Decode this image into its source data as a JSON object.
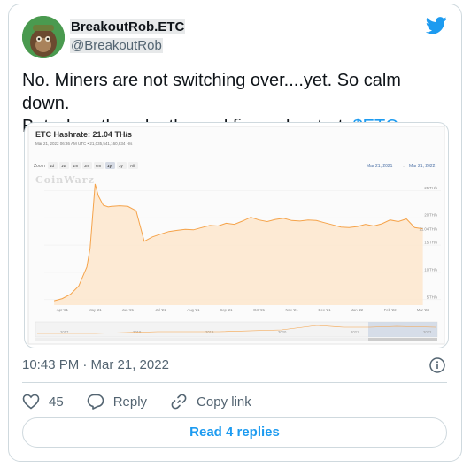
{
  "author": {
    "name": "BreakoutRob.ETC",
    "handle": "@BreakoutRob"
  },
  "tweet": {
    "text_line1": "No. Miners are not switching over....yet. So calm down.",
    "text_line2_plain": "But when they do, the real fireworks start. ",
    "cashtag": "$ETC"
  },
  "embed": {
    "title": "ETC Hashrate: 21.04 TH/s",
    "subtitle": "Mar 21, 2022 06:36 AM UTC  •  21,035,541,160,834 H/s",
    "zoom_label": "Zoom",
    "zoom_options": [
      "1d",
      "1w",
      "1m",
      "3m",
      "6m",
      "1y",
      "3y",
      "All"
    ],
    "zoom_selected": "1y",
    "date_from": "Mar 21, 2021",
    "date_sep": "→",
    "date_to": "Mar 21, 2022",
    "watermark": "CoinWarz",
    "chart_data": {
      "type": "area",
      "title": "ETC Hashrate: 21.04 TH/s",
      "x_tick_labels": [
        "Apr '21",
        "May '21",
        "Jun '21",
        "Jul '21",
        "Aug '21",
        "Sep '21",
        "Oct '21",
        "Nov '21",
        "Dec '21",
        "Jan '22",
        "Feb '22",
        "Mar '22"
      ],
      "y_tick_labels": [
        "5 TH/s",
        "10 TH/s",
        "15 TH/s",
        "20 TH/s",
        "25 TH/s"
      ],
      "y_unit": "TH/s",
      "ylim": [
        4,
        27
      ],
      "series": [
        {
          "color": "#f5a34a",
          "x": [
            0,
            0.25,
            0.5,
            0.75,
            1.0,
            1.1,
            1.25,
            1.35,
            1.5,
            1.65,
            1.75,
            2.0,
            2.25,
            2.5,
            2.75,
            3.0,
            3.25,
            3.5,
            3.75,
            4.0,
            4.25,
            4.5,
            4.75,
            5.0,
            5.25,
            5.5,
            5.75,
            6.0,
            6.25,
            6.5,
            6.75,
            7.0,
            7.25,
            7.5,
            7.75,
            8.0,
            8.25,
            8.5,
            8.75,
            9.0,
            9.25,
            9.5,
            9.75,
            10.0,
            10.25,
            10.5,
            10.75,
            11.0,
            11.25
          ],
          "values": [
            4.8,
            5.2,
            6.0,
            7.5,
            11.0,
            14.5,
            26.2,
            24.0,
            22.3,
            22.0,
            22.1,
            22.2,
            22.1,
            21.3,
            15.7,
            16.5,
            17.0,
            17.5,
            17.7,
            17.9,
            17.8,
            18.2,
            18.6,
            18.5,
            19.0,
            18.8,
            19.4,
            20.1,
            19.6,
            19.3,
            19.7,
            19.9,
            19.5,
            19.4,
            19.6,
            19.5,
            19.1,
            18.7,
            18.3,
            18.2,
            18.4,
            18.8,
            18.5,
            18.9,
            19.6,
            19.3,
            19.8,
            18.2,
            18.0
          ],
          "current_label": "21.04 TH/s"
        }
      ],
      "navigator_labels": [
        "2017",
        "2018",
        "2019",
        "2020",
        "2021",
        "2022"
      ]
    }
  },
  "meta": {
    "timestamp": "10:43 PM · Mar 21, 2022"
  },
  "actions": {
    "like_count": "45",
    "reply_label": "Reply",
    "copy_label": "Copy link"
  },
  "replies_button": "Read 4 replies",
  "colors": {
    "accent": "#1d9bf0",
    "muted": "#536471",
    "chart_line": "#f5a34a",
    "chart_fill": "#fde6cd"
  },
  "icons": [
    "twitter-bird-icon",
    "info-icon",
    "heart-icon",
    "reply-icon",
    "link-icon"
  ]
}
